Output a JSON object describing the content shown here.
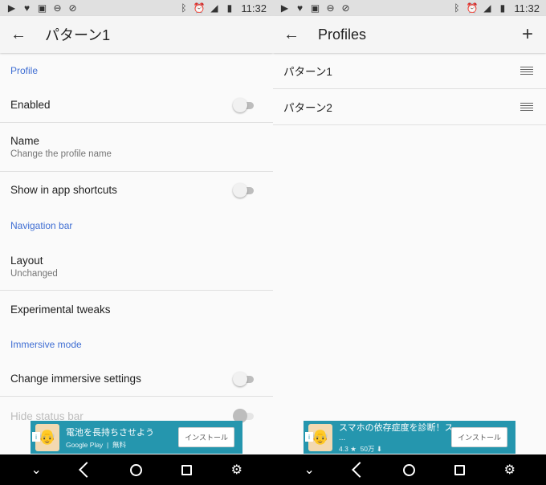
{
  "status_bar": {
    "time": "11:32"
  },
  "left": {
    "title": "パターン1",
    "sections": [
      {
        "header": "Profile"
      },
      {
        "header": "Navigation bar"
      },
      {
        "header": "Immersive mode"
      }
    ],
    "prefs": {
      "enabled": {
        "title": "Enabled",
        "on": false
      },
      "name": {
        "title": "Name",
        "summary": "Change the profile name"
      },
      "shortcuts": {
        "title": "Show in app shortcuts",
        "on": false
      },
      "layout": {
        "title": "Layout",
        "summary": "Unchanged"
      },
      "experimental": {
        "title": "Experimental tweaks"
      },
      "immersive": {
        "title": "Change immersive settings",
        "on": false
      },
      "hide_status": {
        "title": "Hide status bar",
        "on": false,
        "disabled": true
      }
    },
    "ad": {
      "title": "電池を長持ちさせよう",
      "store": "Google Play",
      "price": "無料",
      "button": "インストール"
    }
  },
  "right": {
    "title": "Profiles",
    "profiles": [
      "パターン1",
      "パターン2"
    ],
    "ad": {
      "title": "スマホの依存症度を診断！ス",
      "title_cont": "...",
      "rating": "4.3",
      "downloads": "50万",
      "button": "インストール"
    }
  },
  "icons": {
    "back": "arrow-back-icon",
    "add": "plus-icon",
    "drag": "drag-handle-icon",
    "nav_back": "triangle-back-icon",
    "nav_home": "circle-home-icon",
    "nav_recents": "square-recents-icon",
    "nav_settings": "gear-icon",
    "nav_menu": "chevron-down-icon"
  },
  "colors": {
    "accent": "#3f6ed3",
    "ad_bg": "#2596ae",
    "statusbar": "#e0e0e0"
  }
}
